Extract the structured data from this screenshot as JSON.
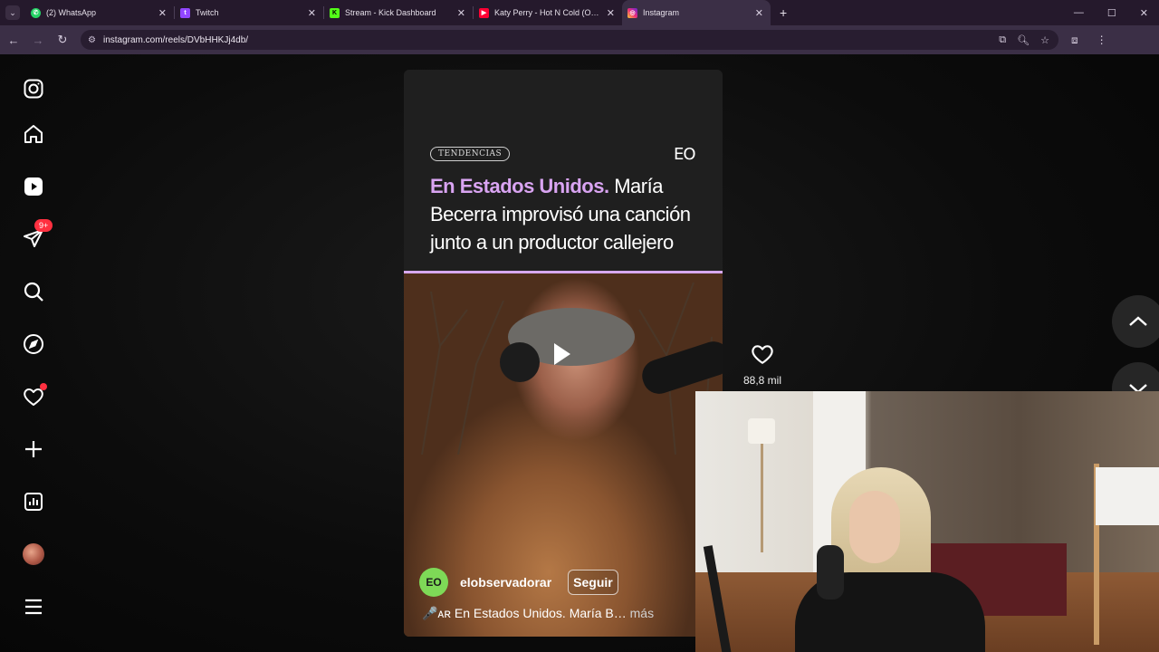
{
  "browser": {
    "tabs": [
      {
        "title": "(2) WhatsApp",
        "icon": "whatsapp-icon",
        "color": "#25d366",
        "active": false
      },
      {
        "title": "Twitch",
        "icon": "twitch-icon",
        "color": "#9146ff",
        "active": false
      },
      {
        "title": "Stream - Kick Dashboard",
        "icon": "kick-icon",
        "color": "#53fc18",
        "active": false
      },
      {
        "title": "Katy Perry - Hot N Cold (Officia",
        "icon": "youtube-icon",
        "color": "#ff0033",
        "active": false
      },
      {
        "title": "Instagram",
        "icon": "instagram-icon",
        "color": "#e1306c",
        "active": true
      }
    ],
    "url": "instagram.com/reels/DVbHHKJj4db/"
  },
  "sidebar": {
    "notifications_badge": "9+"
  },
  "reel": {
    "tag": "TENDENCIAS",
    "logo": "EO",
    "headline_highlight": "En Estados Unidos.",
    "headline_rest": " María Becerra improvisó una canción junto a un productor callejero",
    "author_avatar_text": "EO",
    "author": "elobservadorar",
    "follow_label": "Seguir",
    "caption_prefix": "🎤ᴀʀ",
    "caption": "En Estados Unidos. María B…",
    "caption_more": "más",
    "likes": "88,8 mil"
  },
  "colors": {
    "accent_headline": "#d9a4f2",
    "badge": "#ff3040",
    "author_avatar": "#7ed957"
  }
}
